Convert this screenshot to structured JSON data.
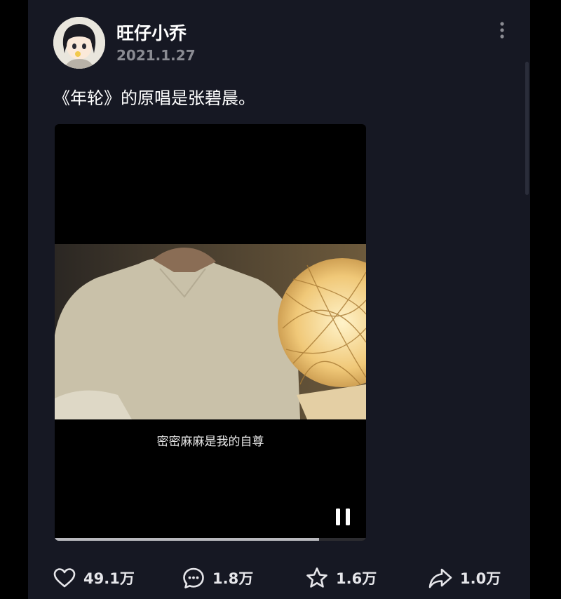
{
  "post": {
    "username": "旺仔小乔",
    "date": "2021.1.27",
    "caption": "《年轮》的原唱是张碧晨。"
  },
  "video": {
    "subtitle": "密密麻麻是我的自尊",
    "progress": 0.85,
    "state": "playing",
    "control_icon": "pause-icon"
  },
  "actions": {
    "like_count": "49.1万",
    "comment_count": "1.8万",
    "favorite_count": "1.6万",
    "share_count": "1.0万"
  },
  "icons": {
    "like": "heart-icon",
    "comment": "comment-bubble-icon",
    "favorite": "star-icon",
    "share": "share-arrow-icon",
    "more": "more-vertical-icon"
  },
  "colors": {
    "background": "#161823",
    "secondary_text": "#8a8b92",
    "lamp_glow": "#f6d48e"
  }
}
